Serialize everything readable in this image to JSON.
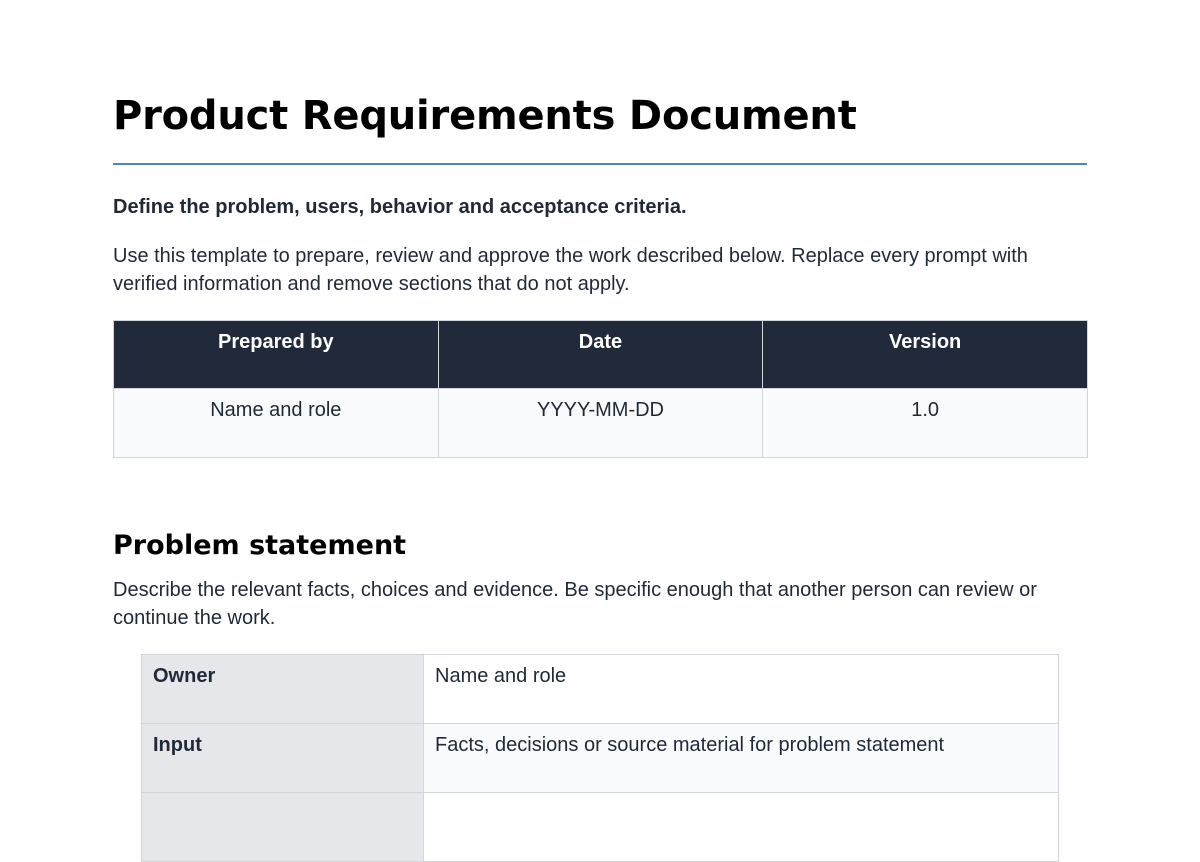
{
  "document": {
    "title": "Product Requirements Document",
    "subtitle": "Define the problem, users, behavior and acceptance criteria.",
    "intro": "Use this template to prepare, review and approve the work described below. Replace every prompt with verified information and remove sections that do not apply."
  },
  "meta_table": {
    "headers": [
      "Prepared by",
      "Date",
      "Version"
    ],
    "values": [
      "Name and role",
      "YYYY-MM-DD",
      "1.0"
    ]
  },
  "section": {
    "heading": "Problem statement",
    "body": "Describe the relevant facts, choices and evidence. Be specific enough that another person can review or continue the work.",
    "rows": [
      {
        "label": "Owner",
        "value": "Name and role"
      },
      {
        "label": "Input",
        "value": "Facts, decisions or source material for problem statement"
      },
      {
        "label": "",
        "value": ""
      }
    ]
  },
  "colors": {
    "rule": "#4a86c8",
    "header_bg": "#202a3a",
    "label_bg": "#e5e7eb"
  }
}
